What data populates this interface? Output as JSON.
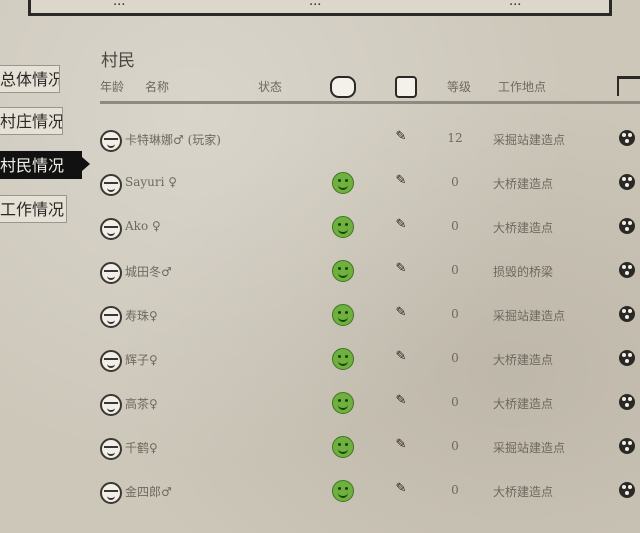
{
  "top_tabs": [
    "...",
    "...",
    "..."
  ],
  "side_tabs": [
    "总体情况",
    "村庄情况",
    "村民情况",
    "工作情况"
  ],
  "section_title": "村民",
  "headers": [
    "年龄",
    "名称",
    "状态",
    "等级",
    "工作地点"
  ],
  "rows": [
    {
      "name": "卡特琳娜♂ (玩家)",
      "mood": "",
      "level": "12",
      "workplace": "采掘站建造点"
    },
    {
      "name": "Sayuri ♀",
      "mood": "happy",
      "level": "0",
      "workplace": "大桥建造点"
    },
    {
      "name": "Ako ♀",
      "mood": "happy",
      "level": "0",
      "workplace": "大桥建造点"
    },
    {
      "name": "城田冬♂",
      "mood": "happy",
      "level": "0",
      "workplace": "损毁的桥梁"
    },
    {
      "name": "寿珠♀",
      "mood": "happy",
      "level": "0",
      "workplace": "采掘站建造点"
    },
    {
      "name": "辉子♀",
      "mood": "happy",
      "level": "0",
      "workplace": "大桥建造点"
    },
    {
      "name": "高茶♀",
      "mood": "happy",
      "level": "0",
      "workplace": "大桥建造点"
    },
    {
      "name": "千鹤♀",
      "mood": "happy",
      "level": "0",
      "workplace": "采掘站建造点"
    },
    {
      "name": "金四郎♂",
      "mood": "happy",
      "level": "0",
      "workplace": "大桥建造点"
    }
  ]
}
